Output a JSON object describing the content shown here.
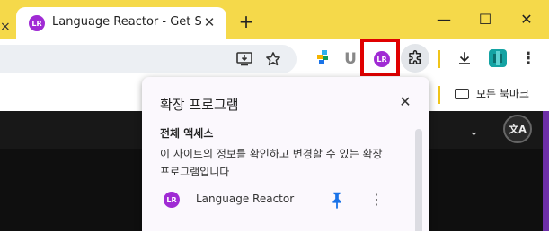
{
  "tab": {
    "title": "Language Reactor - Get Started",
    "favicon_text": "LR",
    "close_glyph": "✕",
    "left_edge_glyph": "×"
  },
  "window": {
    "new_tab_glyph": "+",
    "minimize_glyph": "—",
    "maximize_glyph": "☐",
    "close_glyph": "✕"
  },
  "toolbar": {
    "install_icon": "install-app-icon",
    "star_icon": "bookmark-star-icon",
    "extension_lr_text": "LR",
    "u_icon_text": "U",
    "more_glyph": "⋮"
  },
  "bookmarks": {
    "all_bookmarks_label": "모든 북마크"
  },
  "popup": {
    "title": "확장 프로그램",
    "close_glyph": "✕",
    "section_title": "전체 액세스",
    "description": "이 사이트의 정보를 확인하고 변경할 수 있는 확장 프로그램입니다",
    "items": [
      {
        "name": "Language Reactor",
        "icon_text": "LR",
        "pinned": true,
        "more_glyph": "⋮"
      }
    ]
  },
  "page": {
    "chevron_glyph": "⌄",
    "translate_text": "文A"
  },
  "colors": {
    "tabstrip": "#f5d94a",
    "extension_purple": "#a02bd4",
    "highlight_red": "#e00000",
    "pin_blue": "#1a73e8",
    "page_dark": "#0f0f0f"
  }
}
